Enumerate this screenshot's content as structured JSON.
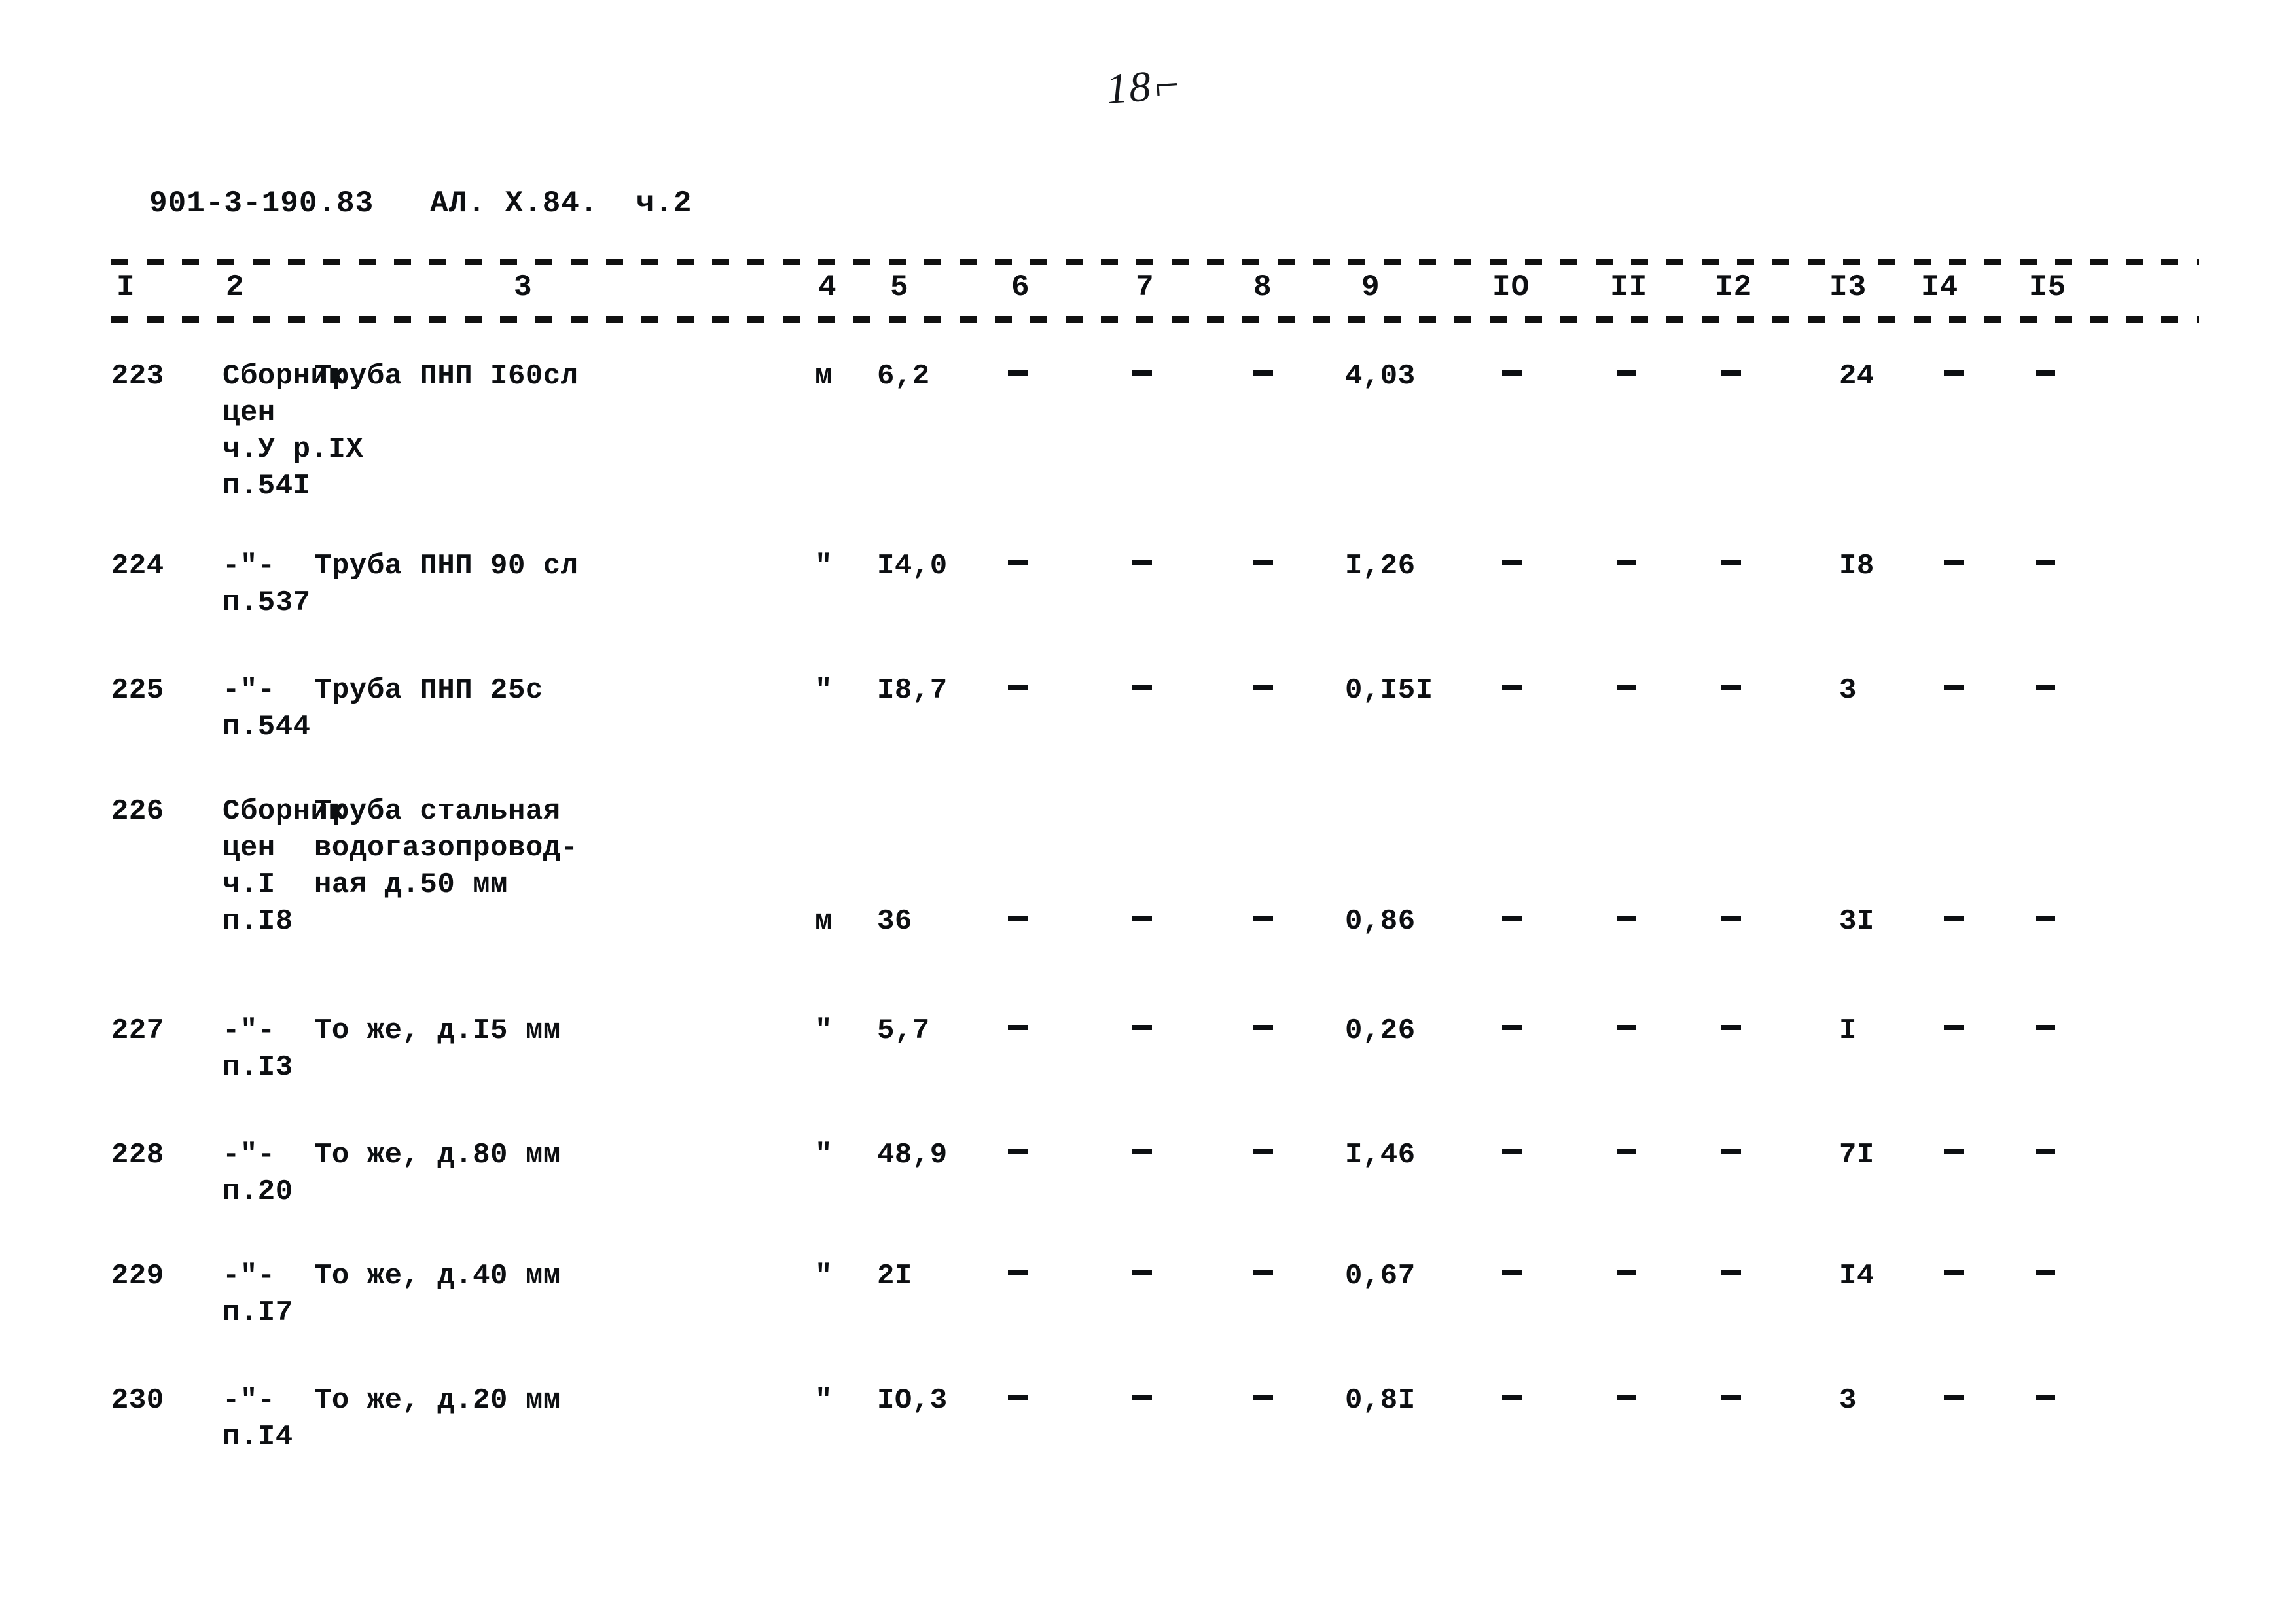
{
  "page": {
    "folio_mark": "18⌐",
    "doc_code": "901-3-190.83   АЛ. Х.84.  ч.2"
  },
  "table": {
    "column_numbers": [
      "I",
      "2",
      "3",
      "4",
      "5",
      "6",
      "7",
      "8",
      "9",
      "IO",
      "II",
      "I2",
      "I3",
      "I4",
      "I5"
    ],
    "dash_glyph": "-",
    "rows": [
      {
        "c1": "223",
        "c2": "Сборник\nцен\nч.У р.IX\nп.54I",
        "c3": "Труба ПНП I60сл",
        "c4": "м",
        "c5": "6,2",
        "c6": "-",
        "c7": "-",
        "c8": "-",
        "c9": "4,03",
        "c10": "-",
        "c11": "-",
        "c12": "-",
        "c13": "24",
        "c14": "-",
        "c15": "-"
      },
      {
        "c1": "224",
        "c2": "-\"-\nп.537",
        "c3": "Труба ПНП 90 сл",
        "c4": "\"",
        "c5": "I4,0",
        "c6": "-",
        "c7": "-",
        "c8": "-",
        "c9": "I,26",
        "c10": "-",
        "c11": "-",
        "c12": "-",
        "c13": "I8",
        "c14": "-",
        "c15": "-"
      },
      {
        "c1": "225",
        "c2": "-\"-\nп.544",
        "c3": "Труба ПНП 25с",
        "c4": "\"",
        "c5": "I8,7",
        "c6": "-",
        "c7": "-",
        "c8": "-",
        "c9": "0,I5I",
        "c10": "-",
        "c11": "-",
        "c12": "-",
        "c13": "3",
        "c14": "-",
        "c15": "-"
      },
      {
        "c1": "226",
        "c2": "Сборник\nцен\nч.I\nп.I8",
        "c3": "Труба стальная\nводогазопровод-\nная д.50 мм",
        "c4": "м",
        "c5": "36",
        "c6": "-",
        "c7": "-",
        "c8": "-",
        "c9": "0,86",
        "c10": "-",
        "c11": "-",
        "c12": "-",
        "c13": "3I",
        "c14": "-",
        "c15": "-"
      },
      {
        "c1": "227",
        "c2": "-\"-\nп.I3",
        "c3": "То же, д.I5 мм",
        "c4": "\"",
        "c5": "5,7",
        "c6": "-",
        "c7": "-",
        "c8": "-",
        "c9": "0,26",
        "c10": "-",
        "c11": "-",
        "c12": "-",
        "c13": "I",
        "c14": "-",
        "c15": "-"
      },
      {
        "c1": "228",
        "c2": "-\"-\nп.20",
        "c3": "То же, д.80 мм",
        "c4": "\"",
        "c5": "48,9",
        "c6": "-",
        "c7": "-",
        "c8": "-",
        "c9": "I,46",
        "c10": "-",
        "c11": "-",
        "c12": "-",
        "c13": "7I",
        "c14": "-",
        "c15": "-"
      },
      {
        "c1": "229",
        "c2": "-\"-\nп.I7",
        "c3": "То же, д.40 мм",
        "c4": "\"",
        "c5": "2I",
        "c6": "-",
        "c7": "-",
        "c8": "-",
        "c9": "0,67",
        "c10": "-",
        "c11": "-",
        "c12": "-",
        "c13": "I4",
        "c14": "-",
        "c15": "-"
      },
      {
        "c1": "230",
        "c2": "-\"-\nп.I4",
        "c3": "То же, д.20 мм",
        "c4": "\"",
        "c5": "IO,3",
        "c6": "-",
        "c7": "-",
        "c8": "-",
        "c9": "0,8I",
        "c10": "-",
        "c11": "-",
        "c12": "-",
        "c13": "3",
        "c14": "-",
        "c15": "-"
      }
    ]
  }
}
